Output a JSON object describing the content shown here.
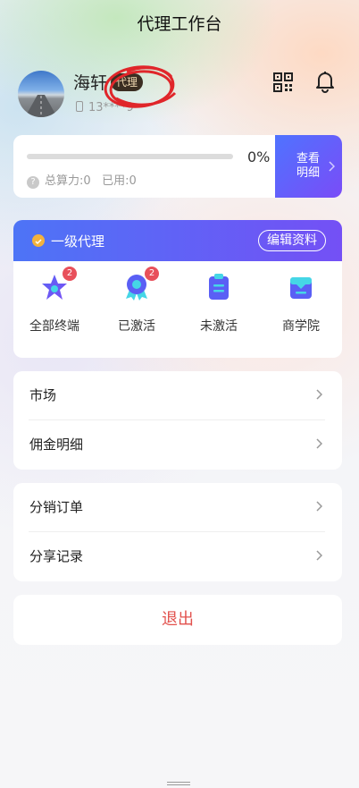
{
  "header": {
    "title": "代理工作台"
  },
  "user": {
    "name": "海轩",
    "role_badge": "代理",
    "phone_masked": "13****9"
  },
  "icons": {
    "qr": "qr-code-icon",
    "bell": "bell-icon"
  },
  "power": {
    "progress_percent": 0,
    "percent_label": "0%",
    "total_label": "总算力:0",
    "used_label": "已用:0",
    "detail_button": [
      "查看",
      "明细"
    ]
  },
  "agent": {
    "level": "一级代理",
    "edit_button": "编辑资料",
    "grid": [
      {
        "label": "全部终端",
        "badge": "2",
        "icon": "star-icon"
      },
      {
        "label": "已激活",
        "badge": "2",
        "icon": "medal-icon"
      },
      {
        "label": "未激活",
        "badge": "",
        "icon": "clipboard-icon"
      },
      {
        "label": "商学院",
        "badge": "",
        "icon": "tray-icon"
      }
    ]
  },
  "menu_group_1": [
    {
      "label": "市场"
    },
    {
      "label": "佣金明细"
    }
  ],
  "menu_group_2": [
    {
      "label": "分销订单"
    },
    {
      "label": "分享记录"
    }
  ],
  "logout": {
    "label": "退出"
  },
  "colors": {
    "accent": "#5b62f6",
    "danger": "#e2514d",
    "badge": "#e8505b"
  }
}
